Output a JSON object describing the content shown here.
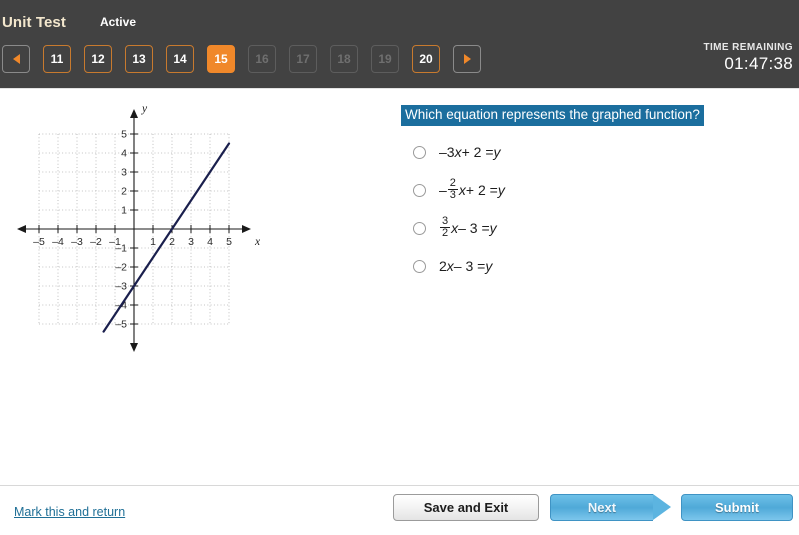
{
  "header": {
    "unit_title": "Unit Test",
    "status": "Active",
    "timer_label": "TIME REMAINING",
    "timer_value": "01:47:38",
    "accent_color": "#f0882a",
    "background_color": "#424242",
    "title_color": "#f3e7cd",
    "pager": {
      "prev_icon": "triangle-left-icon",
      "next_icon": "triangle-right-icon",
      "items": [
        {
          "label": "11",
          "state": "available"
        },
        {
          "label": "12",
          "state": "available"
        },
        {
          "label": "13",
          "state": "available"
        },
        {
          "label": "14",
          "state": "available"
        },
        {
          "label": "15",
          "state": "current"
        },
        {
          "label": "16",
          "state": "disabled"
        },
        {
          "label": "17",
          "state": "disabled"
        },
        {
          "label": "18",
          "state": "disabled"
        },
        {
          "label": "19",
          "state": "disabled"
        },
        {
          "label": "20",
          "state": "available"
        }
      ]
    }
  },
  "question": {
    "text": "Which equation represents the graphed function?",
    "highlight_color": "#1b6e9e"
  },
  "answers": [
    {
      "id": "a",
      "selected": false,
      "parts": [
        {
          "t": "text",
          "v": "–3"
        },
        {
          "t": "var",
          "v": "x"
        },
        {
          "t": "text",
          "v": " + 2 = "
        },
        {
          "t": "var",
          "v": "y"
        }
      ]
    },
    {
      "id": "b",
      "selected": false,
      "parts": [
        {
          "t": "text",
          "v": "–"
        },
        {
          "t": "frac",
          "num": "2",
          "den": "3"
        },
        {
          "t": "var",
          "v": "x"
        },
        {
          "t": "text",
          "v": " + 2 = "
        },
        {
          "t": "var",
          "v": "y"
        }
      ]
    },
    {
      "id": "c",
      "selected": false,
      "parts": [
        {
          "t": "frac",
          "num": "3",
          "den": "2"
        },
        {
          "t": "var",
          "v": "x"
        },
        {
          "t": "text",
          "v": " – 3 = "
        },
        {
          "t": "var",
          "v": "y"
        }
      ]
    },
    {
      "id": "d",
      "selected": false,
      "parts": [
        {
          "t": "text",
          "v": "2"
        },
        {
          "t": "var",
          "v": "x"
        },
        {
          "t": "text",
          "v": " – 3 = "
        },
        {
          "t": "var",
          "v": "y"
        }
      ]
    }
  ],
  "chart_data": {
    "type": "line",
    "title": "",
    "xlabel": "x",
    "ylabel": "y",
    "xlim": [
      -5,
      5
    ],
    "ylim": [
      -5,
      5
    ],
    "grid": true,
    "x_ticks": [
      -5,
      -4,
      -3,
      -2,
      -1,
      1,
      2,
      3,
      4,
      5
    ],
    "y_ticks": [
      -5,
      -4,
      -3,
      -2,
      -1,
      1,
      2,
      3,
      4,
      5
    ],
    "x_tick_labels": [
      "–5",
      "–4",
      "–3",
      "–2",
      "–1",
      "1",
      "2",
      "3",
      "4",
      "5"
    ],
    "y_tick_labels": [
      "–5",
      "–4",
      "–3",
      "–2",
      "–1",
      "1",
      "2",
      "3",
      "4",
      "5"
    ],
    "series": [
      {
        "name": "graphed function",
        "equation": "y = (3/2)x - 3",
        "slope": 1.5,
        "intercept": -3,
        "color": "#1a1f4d",
        "points": [
          [
            -1.6,
            -5.4
          ],
          [
            0,
            -3
          ],
          [
            2,
            0
          ],
          [
            5,
            4.5
          ]
        ],
        "x_intercept": 2,
        "y_intercept": -3
      }
    ],
    "legend": "none"
  },
  "footer": {
    "mark_link": "Mark this and return",
    "save_exit": "Save and Exit",
    "next": "Next",
    "submit": "Submit"
  }
}
